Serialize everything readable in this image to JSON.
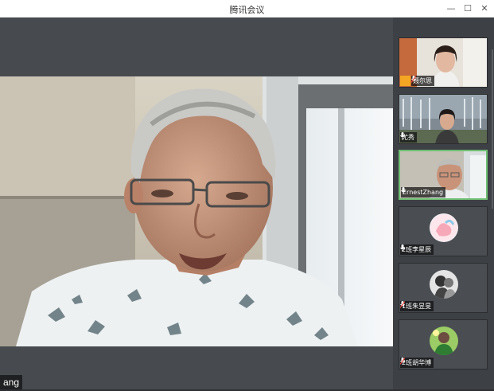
{
  "window": {
    "title": "腾讯会议",
    "minimize_glyph": "—",
    "maximize_glyph": "☐",
    "close_glyph": "✕"
  },
  "main_speaker": {
    "name_label": "ang"
  },
  "participants": [
    {
      "name": "聂尔思",
      "mic": "muted",
      "host": true
    },
    {
      "name": "尤秀",
      "mic": "on",
      "host": false
    },
    {
      "name": "ErnestZhang",
      "mic": "on",
      "host": false,
      "active": true
    },
    {
      "name": "2班李星辰",
      "mic": "on",
      "host": false
    },
    {
      "name": "1班朱昱旻",
      "mic": "muted",
      "host": false
    },
    {
      "name": "2班胡华博",
      "mic": "muted",
      "host": false
    }
  ],
  "colors": {
    "active_border": "#6fbf73",
    "muted_mic": "#e2423b",
    "host_badge": "#f5a623"
  }
}
